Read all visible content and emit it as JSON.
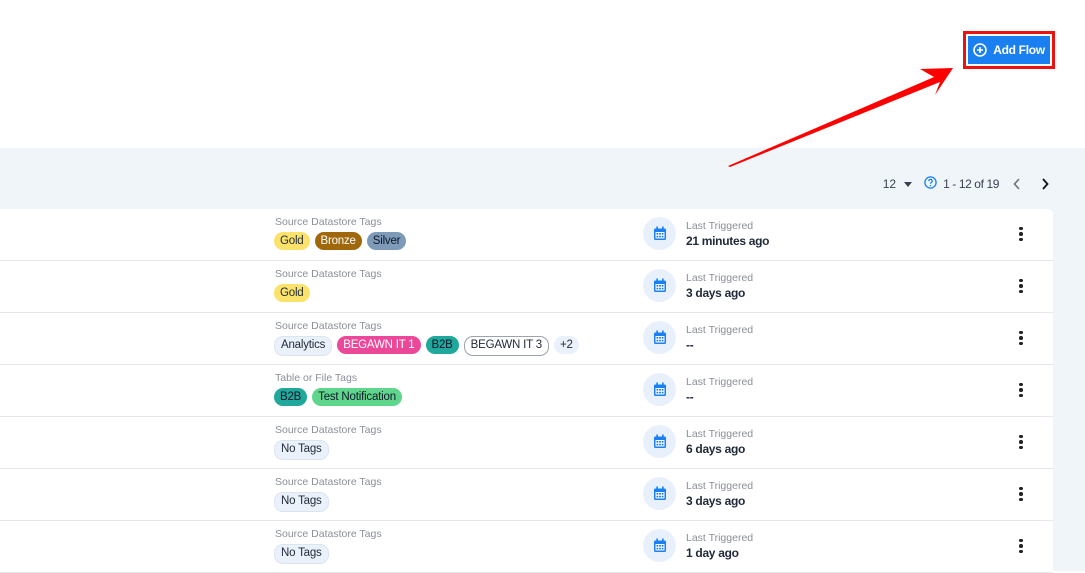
{
  "header": {
    "add_flow_label": "Add Flow",
    "add_flow_icon": "plus-circle-icon",
    "highlight_color": "#ee1111",
    "accent": "#1a7ff0"
  },
  "pagination": {
    "page_size": "12",
    "range": "1 - 12 of 19",
    "help_icon": "question-circle-icon",
    "prev_icon": "chevron-left-icon",
    "next_icon": "chevron-right-icon"
  },
  "rows": [
    {
      "tags_label": "Source Datastore Tags",
      "tags": [
        {
          "text": "Gold",
          "bg": "#fbe36b",
          "fg": "#1f2937",
          "border": "none"
        },
        {
          "text": "Bronze",
          "bg": "#a0680a",
          "fg": "#ffffff",
          "border": "none"
        },
        {
          "text": "Silver",
          "bg": "#7d9ab8",
          "fg": "#111827",
          "border": "none"
        }
      ],
      "trigger_label": "Last Triggered",
      "trigger_value": "21 minutes ago"
    },
    {
      "tags_label": "Source Datastore Tags",
      "tags": [
        {
          "text": "Gold",
          "bg": "#fbe36b",
          "fg": "#1f2937",
          "border": "none"
        }
      ],
      "trigger_label": "Last Triggered",
      "trigger_value": "3 days ago"
    },
    {
      "tags_label": "Source Datastore Tags",
      "tags": [
        {
          "text": "Analytics",
          "bg": "#eaf1fa",
          "fg": "#1f2937",
          "border": "1px solid #dbe5f1"
        },
        {
          "text": "BEGAWN IT 1",
          "bg": "#ec4899",
          "fg": "#ffffff",
          "border": "none"
        },
        {
          "text": "B2B",
          "bg": "#1fa89b",
          "fg": "#0f172a",
          "border": "none"
        },
        {
          "text": "BEGAWN IT 3",
          "bg": "#ffffff",
          "fg": "#1f2937",
          "border": "1px solid #9ca3af"
        },
        {
          "text": "+2",
          "bg": "#eaf1fa",
          "fg": "#1f2937",
          "border": "none"
        }
      ],
      "trigger_label": "Last Triggered",
      "trigger_value": "--"
    },
    {
      "tags_label": "Table or File Tags",
      "tags": [
        {
          "text": "B2B",
          "bg": "#1fa89b",
          "fg": "#0f172a",
          "border": "none"
        },
        {
          "text": "Test Notification",
          "bg": "#5fd68c",
          "fg": "#0f172a",
          "border": "none"
        }
      ],
      "trigger_label": "Last Triggered",
      "trigger_value": "--"
    },
    {
      "tags_label": "Source Datastore Tags",
      "tags": [
        {
          "text": "No Tags",
          "bg": "#eaf1fa",
          "fg": "#1f2937",
          "border": "1px solid #dbe5f1"
        }
      ],
      "trigger_label": "Last Triggered",
      "trigger_value": "6 days ago"
    },
    {
      "tags_label": "Source Datastore Tags",
      "tags": [
        {
          "text": "No Tags",
          "bg": "#eaf1fa",
          "fg": "#1f2937",
          "border": "1px solid #dbe5f1"
        }
      ],
      "trigger_label": "Last Triggered",
      "trigger_value": "3 days ago"
    },
    {
      "tags_label": "Source Datastore Tags",
      "tags": [
        {
          "text": "No Tags",
          "bg": "#eaf1fa",
          "fg": "#1f2937",
          "border": "1px solid #dbe5f1"
        }
      ],
      "trigger_label": "Last Triggered",
      "trigger_value": "1 day ago"
    }
  ]
}
